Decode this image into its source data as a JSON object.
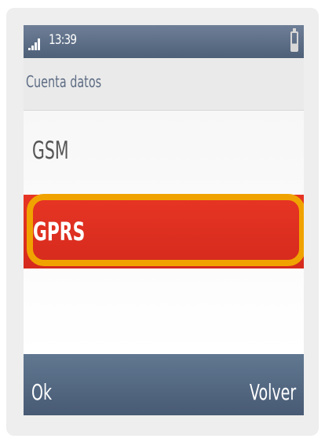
{
  "status": {
    "time": "13:39",
    "icons": [
      "signal-icon",
      "battery-icon"
    ]
  },
  "header": {
    "title": "Cuenta datos"
  },
  "list": {
    "items": [
      {
        "label": "GSM",
        "selected": false
      },
      {
        "label": "GPRS",
        "selected": true
      }
    ]
  },
  "softkeys": {
    "left": "Ok",
    "right": "Volver"
  },
  "colors": {
    "status_bar": "#5f7089",
    "selected_row": "#e23022",
    "highlight_outline": "#f0a300",
    "softkey_bar": "#546983"
  }
}
